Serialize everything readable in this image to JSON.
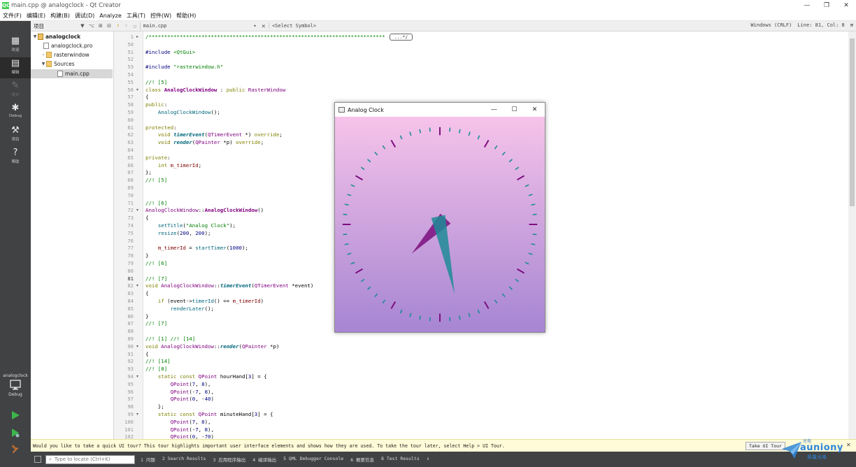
{
  "window": {
    "title": "main.cpp @ analogclock - Qt Creator",
    "app_icon": "QC",
    "controls": [
      "—",
      "❐",
      "✕"
    ]
  },
  "menu": [
    "文件(F)",
    "编辑(E)",
    "构建(B)",
    "调试(D)",
    "Analyze",
    "工具(T)",
    "控件(W)",
    "帮助(H)"
  ],
  "modes": [
    {
      "label": "欢迎",
      "icon": "grid-icon",
      "glyph": "▦",
      "active": false,
      "enabled": true
    },
    {
      "label": "编辑",
      "icon": "edit-icon",
      "glyph": "▤",
      "active": true,
      "enabled": true
    },
    {
      "label": "设计",
      "icon": "design-icon",
      "glyph": "✎",
      "active": false,
      "enabled": false
    },
    {
      "label": "Debug",
      "icon": "bug-icon",
      "glyph": "✱",
      "active": false,
      "enabled": true
    },
    {
      "label": "项目",
      "icon": "wrench-icon",
      "glyph": "⚒",
      "active": false,
      "enabled": true
    },
    {
      "label": "帮助",
      "icon": "help-icon",
      "glyph": "?",
      "active": false,
      "enabled": true
    }
  ],
  "kit": {
    "project": "analogclock",
    "build": "Debug"
  },
  "project_pane": {
    "combo": "项目",
    "toolbar_icons": "▼ ⌥ ⊞ ⊟",
    "tree": [
      {
        "label": "analogclock",
        "depth": 0,
        "arrow": "▼",
        "type": "proj",
        "bold": true
      },
      {
        "label": "analogclock.pro",
        "depth": 1,
        "arrow": "",
        "type": "file",
        "bold": false
      },
      {
        "label": "rasterwindow",
        "depth": 1,
        "arrow": "›",
        "type": "folder",
        "bold": false
      },
      {
        "label": "Sources",
        "depth": 1,
        "arrow": "▼",
        "type": "folder",
        "bold": false
      },
      {
        "label": "main.cpp",
        "depth": 2,
        "arrow": "",
        "type": "file",
        "bold": false,
        "selected": true
      }
    ]
  },
  "editor": {
    "file": "main.cpp",
    "symbol": "<Select Symbol>",
    "encoding": "Windows (CRLF)",
    "position": "Line: 81, Col: 8",
    "current_line": "81"
  },
  "code_lines": [
    {
      "n": "1",
      "fold": "▸",
      "html": "<span class=\"cm\">/****************************************************************************</span><span class=\"fold-box\">...*/</span>"
    },
    {
      "n": "50",
      "html": ""
    },
    {
      "n": "51",
      "html": "<span class=\"pp\">#include</span> <span class=\"str\">&lt;QtGui&gt;</span>"
    },
    {
      "n": "52",
      "html": ""
    },
    {
      "n": "53",
      "html": "<span class=\"pp\">#include</span> <span class=\"str\">\"rasterwindow.h\"</span>"
    },
    {
      "n": "54",
      "html": ""
    },
    {
      "n": "55",
      "html": "<span class=\"cm\">//! [5]</span>"
    },
    {
      "n": "56",
      "fold": "▾",
      "html": "<span class=\"kw\">class</span> <span class=\"cls\">AnalogClockWindow</span> : <span class=\"kw\">public</span> <span class=\"ty\">RasterWindow</span>"
    },
    {
      "n": "57",
      "html": "{"
    },
    {
      "n": "58",
      "html": "<span class=\"kw\">public</span>:"
    },
    {
      "n": "59",
      "html": "    <span class=\"fn\">AnalogClockWindow</span>();"
    },
    {
      "n": "60",
      "html": ""
    },
    {
      "n": "61",
      "html": "<span class=\"kw\">protected</span>:"
    },
    {
      "n": "62",
      "html": "    <span class=\"kw\">void</span> <span class=\"fni\">timerEvent</span>(<span class=\"ty\">QTimerEvent</span> *) <span class=\"kw\">override</span>;"
    },
    {
      "n": "63",
      "html": "    <span class=\"kw\">void</span> <span class=\"fni\">render</span>(<span class=\"ty\">QPainter</span> *p) <span class=\"kw\">override</span>;"
    },
    {
      "n": "64",
      "html": ""
    },
    {
      "n": "65",
      "html": "<span class=\"kw\">private</span>:"
    },
    {
      "n": "66",
      "html": "    <span class=\"kw\">int</span> <span class=\"mem\">m_timerId</span>;"
    },
    {
      "n": "67",
      "html": "};"
    },
    {
      "n": "68",
      "html": "<span class=\"cm\">//! [5]</span>"
    },
    {
      "n": "69",
      "html": ""
    },
    {
      "n": "70",
      "html": ""
    },
    {
      "n": "71",
      "html": "<span class=\"cm\">//! [6]</span>"
    },
    {
      "n": "72",
      "fold": "▾",
      "html": "<span class=\"ty\">AnalogClockWindow</span>::<span class=\"cls\">AnalogClockWindow</span>()"
    },
    {
      "n": "73",
      "html": "{"
    },
    {
      "n": "74",
      "html": "    <span class=\"fn\">setTitle</span>(<span class=\"str\">\"Analog Clock\"</span>);"
    },
    {
      "n": "75",
      "html": "    <span class=\"fn\">resize</span>(<span class=\"num\">200</span>, <span class=\"num\">200</span>);"
    },
    {
      "n": "76",
      "html": ""
    },
    {
      "n": "77",
      "html": "    <span class=\"mem\">m_timerId</span> = <span class=\"fn\">startTimer</span>(<span class=\"num\">1000</span>);"
    },
    {
      "n": "78",
      "html": "}"
    },
    {
      "n": "79",
      "html": "<span class=\"cm\">//! [6]</span>"
    },
    {
      "n": "80",
      "html": ""
    },
    {
      "n": "81",
      "html": "<span class=\"cm\">//! [7]</span>"
    },
    {
      "n": "82",
      "fold": "▾",
      "html": "<span class=\"kw\">void</span> <span class=\"ty\">AnalogClockWindow</span>::<span class=\"fni\">timerEvent</span>(<span class=\"ty\">QTimerEvent</span> *event)"
    },
    {
      "n": "83",
      "html": "{"
    },
    {
      "n": "84",
      "html": "    <span class=\"kw\">if</span> (event-&gt;<span class=\"fn\">timerId</span>() == <span class=\"mem\">m_timerId</span>)"
    },
    {
      "n": "85",
      "html": "        <span class=\"fn\">renderLater</span>();"
    },
    {
      "n": "86",
      "html": "}"
    },
    {
      "n": "87",
      "html": "<span class=\"cm\">//! [7]</span>"
    },
    {
      "n": "88",
      "html": ""
    },
    {
      "n": "89",
      "html": "<span class=\"cm\">//! [1] //! [14]</span>"
    },
    {
      "n": "90",
      "fold": "▾",
      "html": "<span class=\"kw\">void</span> <span class=\"ty\">AnalogClockWindow</span>::<span class=\"fni\">render</span>(<span class=\"ty\">QPainter</span> *p)"
    },
    {
      "n": "91",
      "html": "{"
    },
    {
      "n": "92",
      "html": "<span class=\"cm\">//! [14]</span>"
    },
    {
      "n": "93",
      "html": "<span class=\"cm\">//! [8]</span>"
    },
    {
      "n": "94",
      "fold": "▾",
      "html": "    <span class=\"kw\">static</span> <span class=\"kw\">const</span> <span class=\"ty\">QPoint</span> hourHand[<span class=\"num\">3</span>] = {"
    },
    {
      "n": "95",
      "html": "        <span class=\"ty\">QPoint</span>(<span class=\"num\">7</span>, <span class=\"num\">8</span>),"
    },
    {
      "n": "96",
      "html": "        <span class=\"ty\">QPoint</span>(-<span class=\"num\">7</span>, <span class=\"num\">8</span>),"
    },
    {
      "n": "97",
      "html": "        <span class=\"ty\">QPoint</span>(<span class=\"num\">0</span>, -<span class=\"num\">40</span>)"
    },
    {
      "n": "98",
      "html": "    };"
    },
    {
      "n": "99",
      "fold": "▾",
      "html": "    <span class=\"kw\">static</span> <span class=\"kw\">const</span> <span class=\"ty\">QPoint</span> minuteHand[<span class=\"num\">3</span>] = {"
    },
    {
      "n": "100",
      "html": "        <span class=\"ty\">QPoint</span>(<span class=\"num\">7</span>, <span class=\"num\">8</span>),"
    },
    {
      "n": "101",
      "html": "        <span class=\"ty\">QPoint</span>(-<span class=\"num\">7</span>, <span class=\"num\">8</span>),"
    },
    {
      "n": "102",
      "html": "        <span class=\"ty\">QPoint</span>(<span class=\"num\">0</span>, -<span class=\"num\">70</span>)"
    }
  ],
  "tour": {
    "message": "Would you like to take a quick UI tour? This tour highlights important user interface elements and shows how they are used. To take the tour later, select Help > UI Tour.",
    "button": "Take UI Tour",
    "close": "✕"
  },
  "statusbar": {
    "locate_placeholder": "Type to locate (Ctrl+K)",
    "panes": [
      "1 问题",
      "2 Search Results",
      "3 应用程序输出",
      "4 编译输出",
      "5 QML Debugger Console",
      "6 概要信息",
      "8 Test Results"
    ],
    "updown": "⇕"
  },
  "watermark": {
    "top": "光电",
    "brand": "auniony",
    "sub": "昊量光电"
  },
  "clock_window": {
    "title": "Analog Clock",
    "controls": [
      "—",
      "☐",
      "✕"
    ],
    "time": {
      "hour": 7,
      "minute": 28
    },
    "colors": {
      "bg_top": "#f6c3ea",
      "bg_bottom": "#a685d2",
      "hour": "#7d0f7f",
      "minute": "#1f8b97"
    }
  }
}
